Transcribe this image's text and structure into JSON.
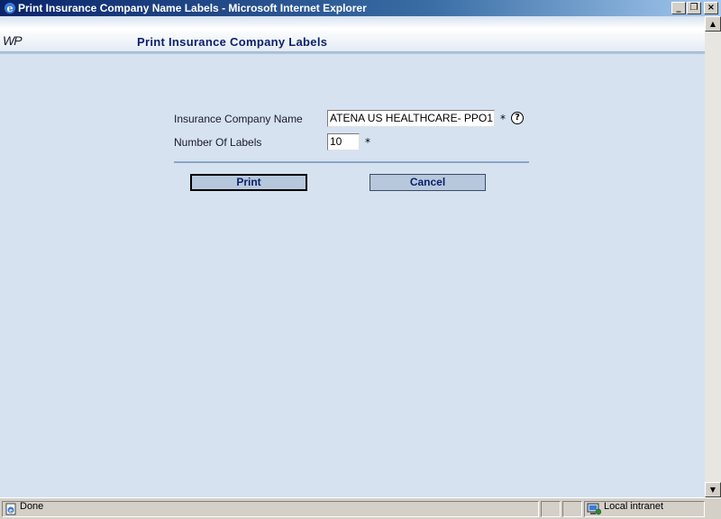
{
  "window": {
    "title": "Print Insurance Company Name Labels - Microsoft Internet Explorer",
    "minimize": "_",
    "restore": "❐",
    "close": "×"
  },
  "header": {
    "logo": "WP",
    "title": "Print Insurance Company Labels"
  },
  "form": {
    "company_label": "Insurance Company Name",
    "company_value": "ATENA US HEALTHCARE- PPO1",
    "labels_label": "Number Of Labels",
    "labels_value": "10",
    "required_mark": "*",
    "help": "?"
  },
  "buttons": {
    "print": "Print",
    "cancel": "Cancel"
  },
  "status": {
    "text": "Done",
    "zone": "Local intranet"
  },
  "colors": {
    "accent": "#0a1f6b",
    "background": "#d6e2f0"
  }
}
